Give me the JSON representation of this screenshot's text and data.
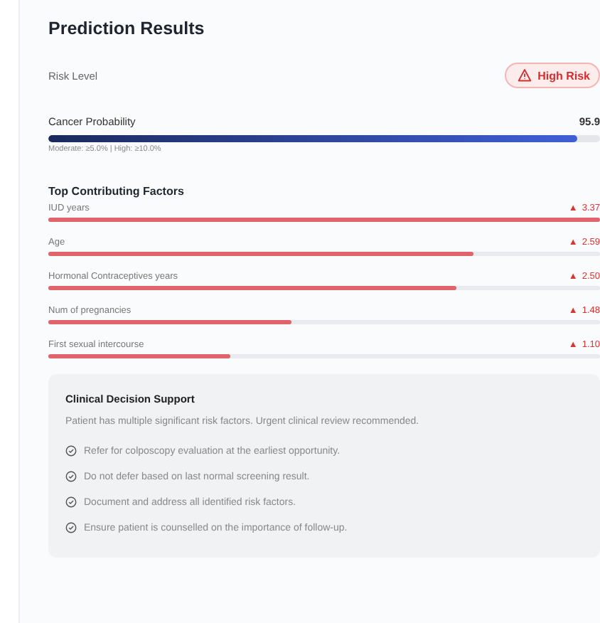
{
  "title": "Prediction Results",
  "risk": {
    "label": "Risk Level",
    "badge": "High Risk",
    "kind": "high"
  },
  "probability": {
    "label": "Cancer Probability",
    "value": "95.9",
    "level": 0.959,
    "thresholds": "Moderate: ≥5.0% | High: ≥10.0%"
  },
  "factors_title": "Top Contributing Factors",
  "factors": [
    {
      "name": "IUD years",
      "arrow": "▲",
      "value": "3.37",
      "level": 1.0
    },
    {
      "name": "Age",
      "arrow": "▲",
      "value": "2.59",
      "level": 0.77
    },
    {
      "name": "Hormonal Contraceptives years",
      "arrow": "▲",
      "value": "2.50",
      "level": 0.74
    },
    {
      "name": "Num of pregnancies",
      "arrow": "▲",
      "value": "1.48",
      "level": 0.44
    },
    {
      "name": "First sexual intercourse",
      "arrow": "▲",
      "value": "1.10",
      "level": 0.33
    }
  ],
  "support": {
    "title": "Clinical Decision Support",
    "summary": "Patient has multiple significant risk factors. Urgent clinical review recommended.",
    "items": [
      "Refer for colposcopy evaluation at the earliest opportunity.",
      "Do not defer based on last normal screening result.",
      "Document and address all identified risk factors.",
      "Ensure patient is counselled on the importance of follow-up."
    ]
  }
}
